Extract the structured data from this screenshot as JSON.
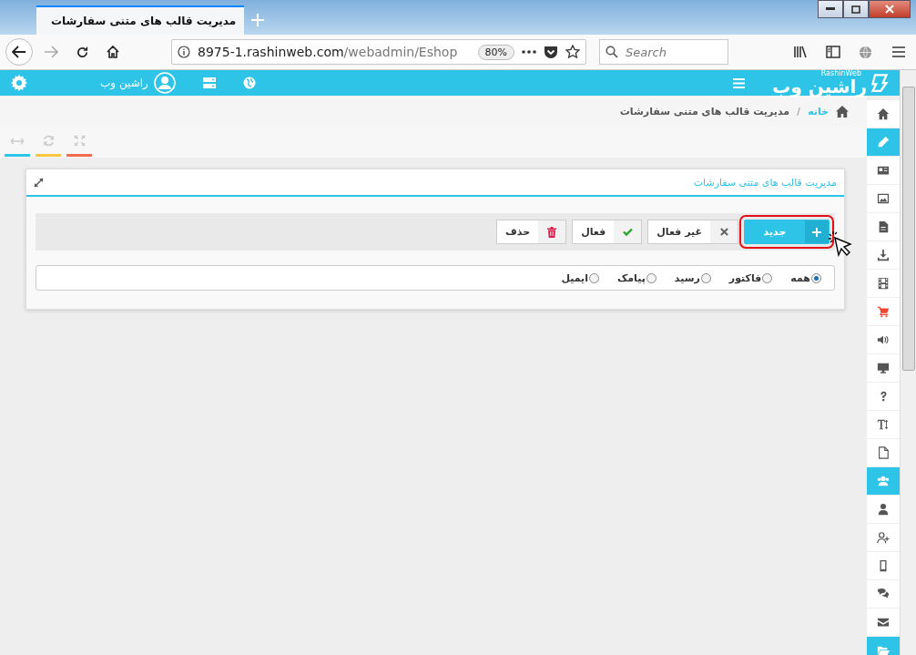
{
  "browser": {
    "tab_title": "مدیریت قالب های متنی سفارشات",
    "url_host": "8975-1.rashinweb.com",
    "url_path": "/webadmin/Eshop",
    "zoom": "80%",
    "search": {
      "placeholder": "Search"
    }
  },
  "header": {
    "logo_text": "راشین وب",
    "logo_subtext": "RashinWeb",
    "user_name": "راشین وب"
  },
  "breadcrumb_separator": "/",
  "breadcrumb": [
    {
      "label": "خانه",
      "link": true
    },
    {
      "label": "مدیریت قالب های متنی سفارشات",
      "link": false
    }
  ],
  "panel_tools": [
    {
      "kind": "resize",
      "color": "#2ec4e8"
    },
    {
      "kind": "refresh",
      "color": "#f9c641"
    },
    {
      "kind": "expand",
      "color": "#f26c4f"
    }
  ],
  "panel": {
    "title": "مدیریت قالب های متنی سفارشات",
    "buttons": [
      {
        "kind": "new",
        "label": "جدید",
        "highlighted": true
      },
      {
        "kind": "deactivate",
        "label": "غیر فعال",
        "highlighted": false
      },
      {
        "kind": "activate",
        "label": "فعال",
        "highlighted": false
      },
      {
        "kind": "delete",
        "label": "حذف",
        "highlighted": false
      }
    ],
    "filters": [
      {
        "label": "همه",
        "selected": true
      },
      {
        "label": "فاکتور",
        "selected": false
      },
      {
        "label": "رسید",
        "selected": false
      },
      {
        "label": "پیامک",
        "selected": false
      },
      {
        "label": "ایمیل",
        "selected": false
      }
    ]
  },
  "sidebar": [
    {
      "kind": "home",
      "selected": false
    },
    {
      "kind": "pencil",
      "selected": true
    },
    {
      "kind": "id-card",
      "selected": false
    },
    {
      "kind": "image",
      "selected": false
    },
    {
      "kind": "document",
      "selected": false
    },
    {
      "kind": "download",
      "selected": false
    },
    {
      "kind": "film",
      "selected": false
    },
    {
      "kind": "cart",
      "selected": false
    },
    {
      "kind": "speaker",
      "selected": false
    },
    {
      "kind": "monitor",
      "selected": false
    },
    {
      "kind": "question",
      "selected": false
    },
    {
      "kind": "text-height",
      "selected": false
    },
    {
      "kind": "blank-page",
      "selected": false
    },
    {
      "kind": "users",
      "selected": true
    },
    {
      "kind": "user",
      "selected": false
    },
    {
      "kind": "user-plus",
      "selected": false
    },
    {
      "kind": "phone",
      "selected": false
    },
    {
      "kind": "chat",
      "selected": false
    },
    {
      "kind": "envelope",
      "selected": false
    },
    {
      "kind": "folder",
      "selected": true
    }
  ]
}
